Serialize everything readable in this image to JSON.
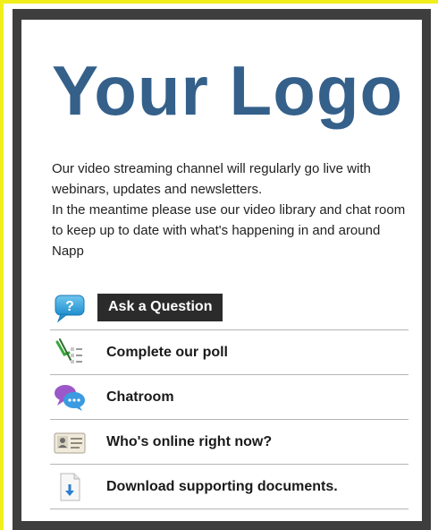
{
  "logo": {
    "text": "Your Logo",
    "color": "#34608a"
  },
  "intro": {
    "paragraph_1": "Our video streaming channel will regularly go live with webinars, updates and newsletters.",
    "paragraph_2": "In the meantime please use our video library and chat room to keep up to date with what's happening in and around Napp"
  },
  "menu": {
    "items": [
      {
        "label": "Ask a Question",
        "icon": "question-bubble-icon",
        "active": true
      },
      {
        "label": "Complete our poll",
        "icon": "poll-checklist-icon",
        "active": false
      },
      {
        "label": "Chatroom",
        "icon": "chat-bubbles-icon",
        "active": false
      },
      {
        "label": "Who's online right now?",
        "icon": "people-card-icon",
        "active": false
      },
      {
        "label": "Download supporting documents.",
        "icon": "document-download-icon",
        "active": false
      }
    ]
  },
  "colors": {
    "frame": "#3e3e3e",
    "yellow_edge": "#f2ee1c",
    "active_item_bg": "#2b2b2b",
    "divider": "#b5b5b5"
  }
}
